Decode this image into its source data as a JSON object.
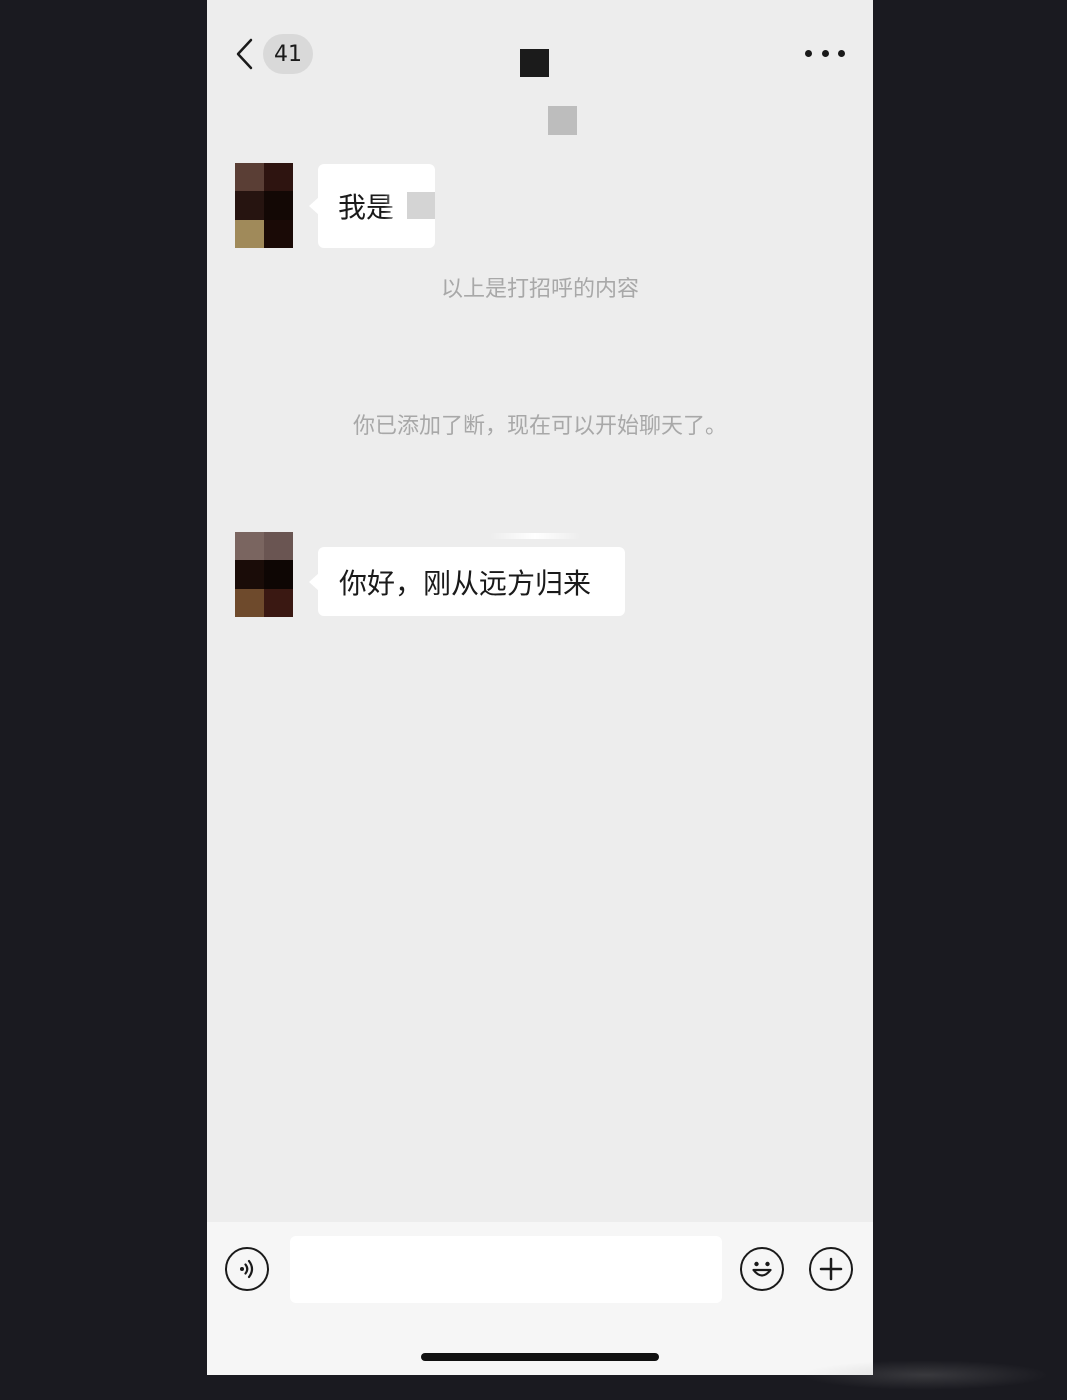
{
  "header": {
    "unread_count": "41",
    "back_icon": "chevron-left-icon",
    "more_icon": "more-horizontal-icon"
  },
  "messages": [
    {
      "sender": "contact",
      "text": "我是",
      "avatar_colors": [
        "#5a3e35",
        "#2e1410",
        "#261410",
        "#130805",
        "#a08a5a",
        "#1a0a06"
      ]
    },
    {
      "sender": "contact",
      "text": "你好，刚从远方归来",
      "avatar_colors": [
        "#7a6560",
        "#6a5552",
        "#1a0c08",
        "#0e0604",
        "#6e4a2c",
        "#3a1812"
      ]
    }
  ],
  "system_notes": {
    "greeting_note": "以上是打招呼的内容",
    "added_note": "你已添加了断，现在可以开始聊天了。"
  },
  "input_bar": {
    "voice_icon": "voice-icon",
    "emoji_icon": "emoji-icon",
    "plus_icon": "plus-icon",
    "input_value": ""
  },
  "colors": {
    "chat_background": "#ededed",
    "bubble_background": "#ffffff",
    "system_text": "#a8a8a8",
    "outer_background": "#1a1a20"
  }
}
